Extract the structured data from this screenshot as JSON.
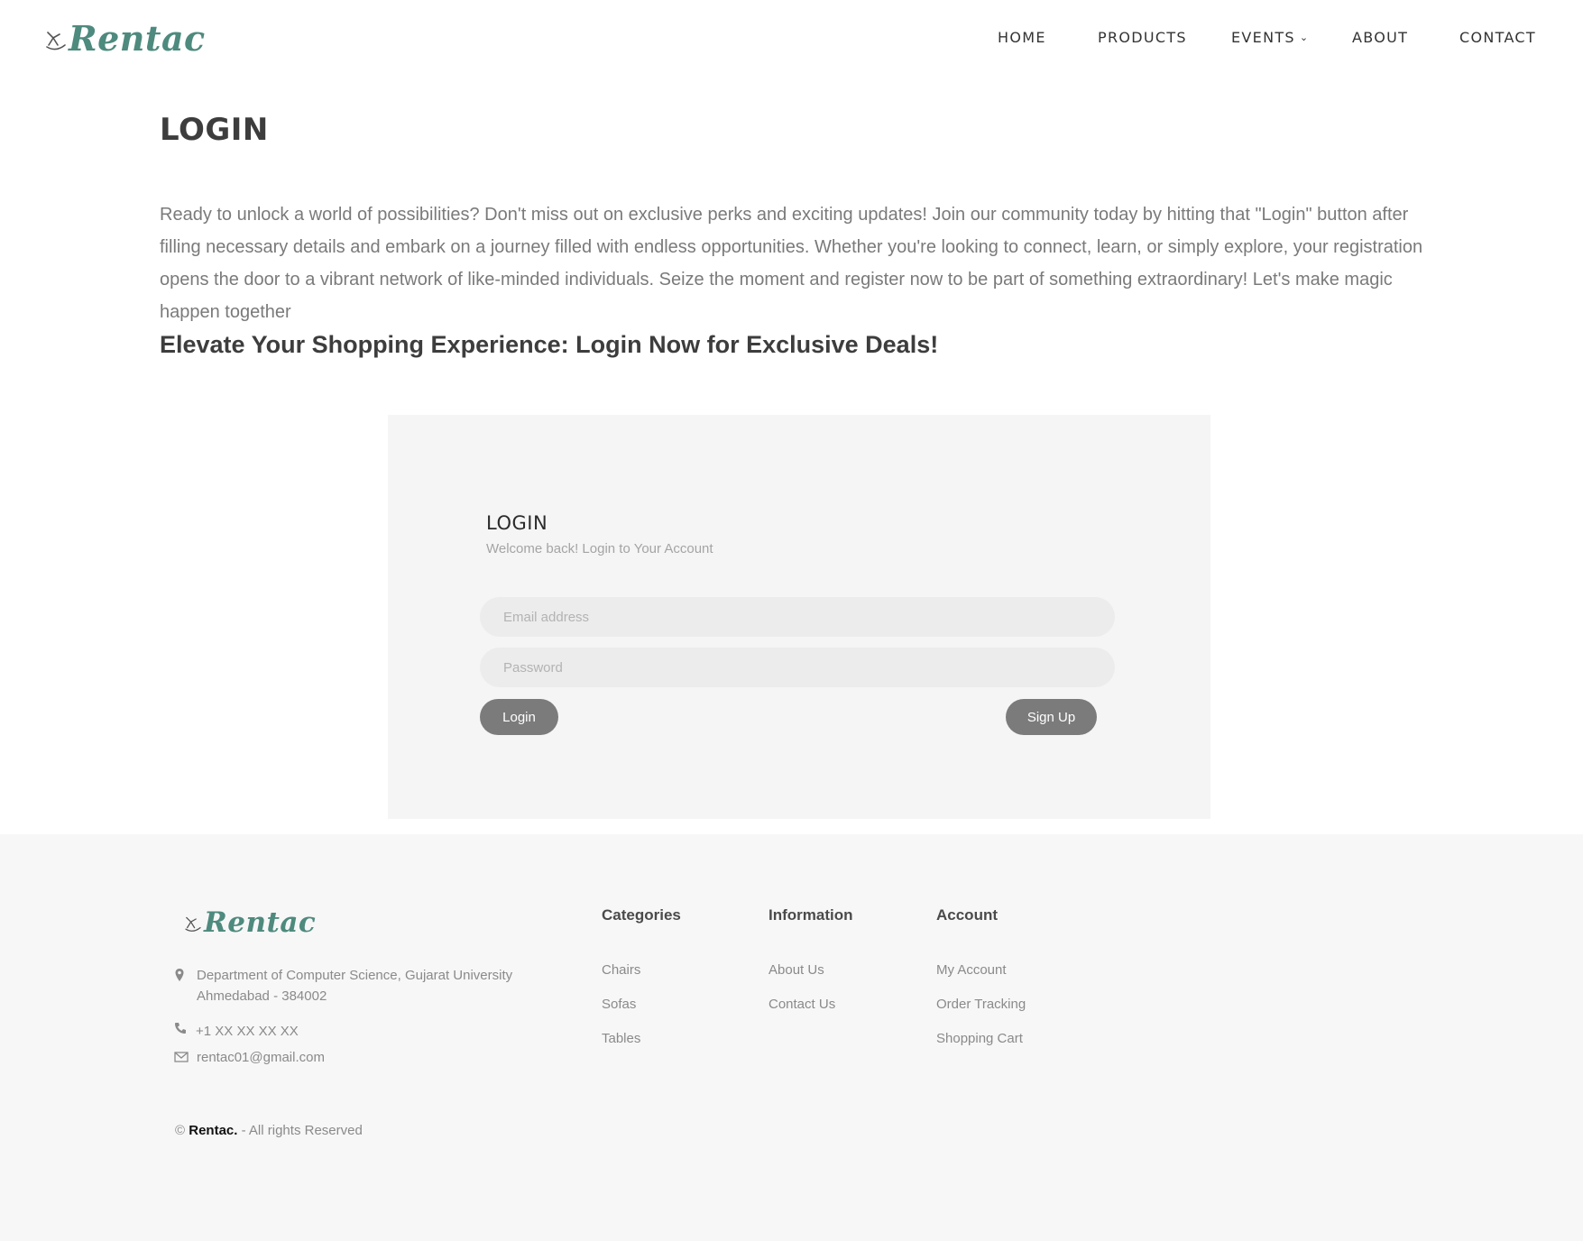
{
  "header": {
    "logo_text": "Rentac",
    "nav": [
      {
        "label": "HOME"
      },
      {
        "label": "PRODUCTS"
      },
      {
        "label": "EVENTS",
        "has_dropdown": true
      },
      {
        "label": "ABOUT"
      },
      {
        "label": "CONTACT"
      }
    ]
  },
  "main": {
    "page_title": "LOGIN",
    "intro": "Ready to unlock a world of possibilities? Don't miss out on exclusive perks and exciting updates! Join our community today by hitting that \"Login\" button after filling necessary details and embark on a journey filled with endless opportunities. Whether you're looking to connect, learn, or simply explore, your registration opens the door to a vibrant network of like-minded individuals. Seize the moment and register now to be part of something extraordinary! Let's make magic happen together",
    "subheading": "Elevate Your Shopping Experience: Login Now for Exclusive Deals!"
  },
  "login_form": {
    "title": "LOGIN",
    "subtitle": "Welcome back! Login to Your Account",
    "email_placeholder": "Email address",
    "password_placeholder": "Password",
    "login_label": "Login",
    "signup_label": "Sign Up"
  },
  "footer": {
    "logo_text": "Rentac",
    "address_line1": "Department of Computer Science, Gujarat University",
    "address_line2": "Ahmedabad - 384002",
    "phone": "+1 XX XX XX XX",
    "email": "rentac01@gmail.com",
    "columns": [
      {
        "title": "Categories",
        "links": [
          "Chairs",
          "Sofas",
          "Tables"
        ]
      },
      {
        "title": "Information",
        "links": [
          "About Us",
          "Contact Us"
        ]
      },
      {
        "title": "Account",
        "links": [
          "My Account",
          "Order Tracking",
          "Shopping Cart"
        ]
      }
    ],
    "copyright_symbol": "©",
    "copyright_brand": "Rentac.",
    "copyright_rest": "- All rights Reserved"
  },
  "colors": {
    "brand": "#4e8a7e",
    "button": "#7b7b7b",
    "card_bg": "#f5f5f5",
    "footer_bg": "#f7f7f7"
  },
  "icons": [
    "rocking-horse-logo-icon",
    "chevron-down-icon",
    "map-pin-icon",
    "phone-icon",
    "mail-icon"
  ]
}
